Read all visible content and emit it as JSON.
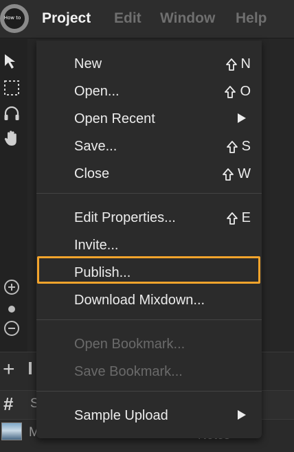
{
  "logo": {
    "text": "How to"
  },
  "menubar": {
    "items": [
      {
        "label": "Project",
        "active": true
      },
      {
        "label": "Edit",
        "active": false
      },
      {
        "label": "Window",
        "active": false
      },
      {
        "label": "Help",
        "active": false
      }
    ]
  },
  "tools": [
    "pointer-arrow-icon",
    "marquee-select-icon",
    "headphones-icon",
    "hand-icon",
    "zoom-in-icon",
    "zoom-dot-icon",
    "zoom-out-icon"
  ],
  "dropdown": {
    "items": [
      {
        "label": "New",
        "shortcut_key": "N",
        "shift": true
      },
      {
        "label": "Open...",
        "shortcut_key": "O",
        "shift": true
      },
      {
        "label": "Open Recent",
        "submenu": true
      },
      {
        "label": "Save...",
        "shortcut_key": "S",
        "shift": true
      },
      {
        "label": "Close",
        "shortcut_key": "W",
        "shift": true
      },
      {
        "label": "Edit Properties...",
        "shortcut_key": "E",
        "shift": true
      },
      {
        "label": "Invite..."
      },
      {
        "label": "Publish...",
        "highlighted": true
      },
      {
        "label": "Download Mixdown..."
      },
      {
        "label": "Open Bookmark...",
        "disabled": true
      },
      {
        "label": "Save Bookmark...",
        "disabled": true
      },
      {
        "label": "Sample Upload",
        "submenu": true
      }
    ]
  },
  "lower_panel": {
    "row2_peek": "S",
    "row3_peek": "M",
    "notes_label": "Notes"
  },
  "colors": {
    "highlight": "#f3a42c",
    "menu_bg": "#2b2b2b",
    "text": "#ececec",
    "disabled_text": "#6a6a6a"
  }
}
